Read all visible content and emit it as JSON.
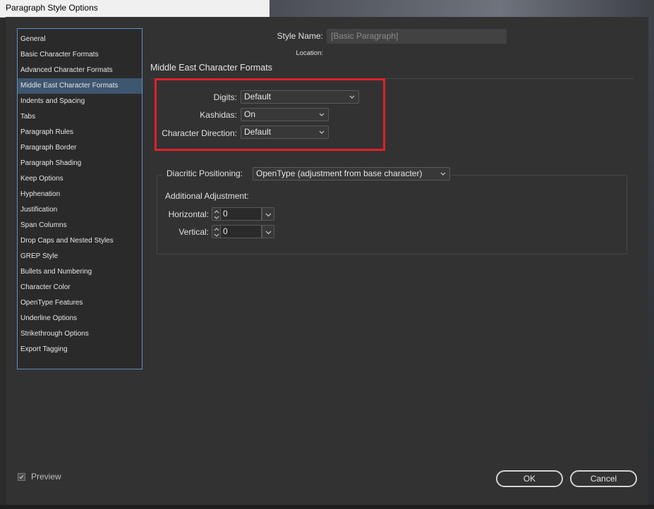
{
  "window": {
    "title": "Paragraph Style Options"
  },
  "sidebar": {
    "items": [
      {
        "label": "General"
      },
      {
        "label": "Basic Character Formats"
      },
      {
        "label": "Advanced Character Formats"
      },
      {
        "label": "Middle East Character Formats",
        "selected": true
      },
      {
        "label": "Indents and Spacing"
      },
      {
        "label": "Tabs"
      },
      {
        "label": "Paragraph Rules"
      },
      {
        "label": "Paragraph Border"
      },
      {
        "label": "Paragraph Shading"
      },
      {
        "label": "Keep Options"
      },
      {
        "label": "Hyphenation"
      },
      {
        "label": "Justification"
      },
      {
        "label": "Span Columns"
      },
      {
        "label": "Drop Caps and Nested Styles"
      },
      {
        "label": "GREP Style"
      },
      {
        "label": "Bullets and Numbering"
      },
      {
        "label": "Character Color"
      },
      {
        "label": "OpenType Features"
      },
      {
        "label": "Underline Options"
      },
      {
        "label": "Strikethrough Options"
      },
      {
        "label": "Export Tagging"
      }
    ]
  },
  "header": {
    "style_name_label": "Style Name:",
    "style_name_value": "[Basic Paragraph]",
    "location_label": "Location:"
  },
  "section": {
    "title": "Middle East Character Formats",
    "digits_label": "Digits:",
    "digits_value": "Default",
    "kashidas_label": "Kashidas:",
    "kashidas_value": "On",
    "direction_label": "Character Direction:",
    "direction_value": "Default",
    "highlight_color": "#e0202b"
  },
  "diacritic": {
    "label": "Diacritic Positioning:",
    "value": "OpenType (adjustment from base character)",
    "additional_label": "Additional Adjustment:",
    "horizontal_label": "Horizontal:",
    "horizontal_value": "0",
    "vertical_label": "Vertical:",
    "vertical_value": "0"
  },
  "footer": {
    "preview_label": "Preview",
    "preview_checked": true,
    "ok_label": "OK",
    "cancel_label": "Cancel"
  },
  "colors": {
    "dialog_bg": "#323232",
    "selection": "#3e5670",
    "list_border": "#5e8fbf"
  }
}
